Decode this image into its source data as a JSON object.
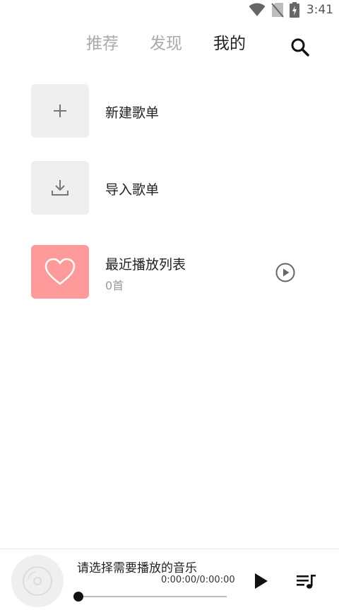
{
  "status_bar": {
    "time": "3:41",
    "icons": [
      "wifi-icon",
      "no-sim-icon",
      "battery-charging-icon"
    ]
  },
  "top_nav": {
    "tabs": [
      {
        "label": "推荐",
        "active": false
      },
      {
        "label": "发现",
        "active": false
      },
      {
        "label": "我的",
        "active": true
      }
    ],
    "search_icon": "search-icon"
  },
  "playlists": [
    {
      "title": "新建歌单",
      "icon": "plus-icon"
    },
    {
      "title": "导入歌单",
      "icon": "import-icon"
    },
    {
      "title": "最近播放列表",
      "subtitle": "0首",
      "icon": "heart-icon",
      "action_icon": "play-circle-icon",
      "accent": "#fe9a9a"
    }
  ],
  "player": {
    "title": "请选择需要播放的音乐",
    "time": "0:00:00/0:00:00",
    "progress": 0,
    "play_icon": "play-icon",
    "playlist_icon": "queue-music-icon"
  }
}
